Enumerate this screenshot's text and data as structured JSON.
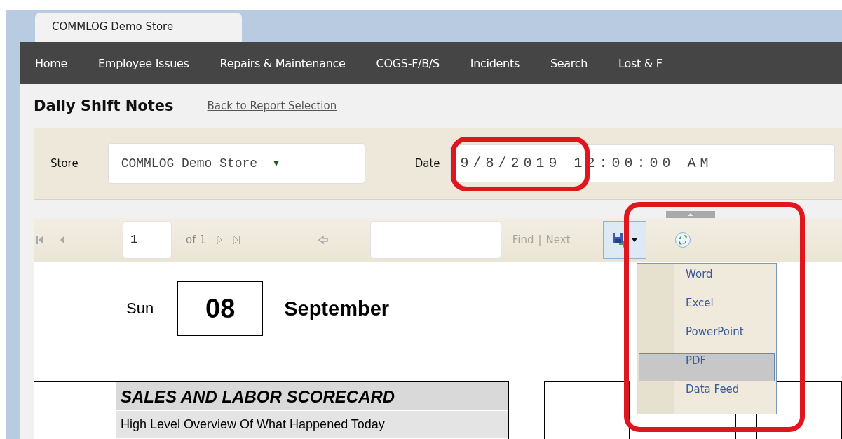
{
  "tab": {
    "label": "COMMLOG Demo Store",
    "selected": true
  },
  "nav": [
    {
      "label": "Home"
    },
    {
      "label": "Employee Issues"
    },
    {
      "label": "Repairs & Maintenance"
    },
    {
      "label": "COGS-F/B/S"
    },
    {
      "label": "Incidents"
    },
    {
      "label": "Search"
    },
    {
      "label": "Lost & F"
    }
  ],
  "page_title": "Daily Shift Notes",
  "back_link": "Back to Report Selection",
  "filters": {
    "store_label": "Store",
    "store_value": "COMMLOG Demo Store",
    "date_label": "Date",
    "date_value": "9/8/2019 12:00:00 AM"
  },
  "toolbar": {
    "page": "1",
    "page_count": "of 1",
    "find": "Find",
    "separator": "|",
    "next": "Next"
  },
  "export_menu": {
    "expanded": true,
    "items": [
      {
        "label": "Word",
        "selected": false
      },
      {
        "label": "Excel",
        "selected": false
      },
      {
        "label": "PowerPoint",
        "selected": false
      },
      {
        "label": "PDF",
        "selected": true
      },
      {
        "label": "Data Feed",
        "selected": false
      }
    ]
  },
  "report": {
    "weekday": "Sun",
    "day": "08",
    "month": "September",
    "scorecard_title": "SALES AND LABOR SCORECARD",
    "scorecard_subtitle": "High Level Overview Of What Happened Today"
  }
}
